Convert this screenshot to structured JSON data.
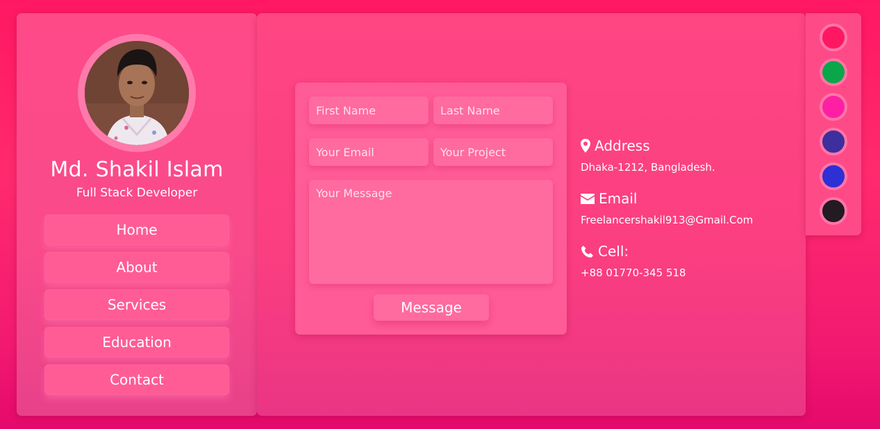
{
  "profile": {
    "name": "Md. Shakil Islam",
    "role": "Full Stack Developer",
    "avatar_icon": "profile-photo"
  },
  "nav": {
    "items": [
      {
        "label": "Home"
      },
      {
        "label": "About"
      },
      {
        "label": "Services"
      },
      {
        "label": "Education"
      },
      {
        "label": "Contact"
      }
    ]
  },
  "form": {
    "first_name_placeholder": "First Name",
    "last_name_placeholder": "Last Name",
    "email_placeholder": "Your Email",
    "project_placeholder": "Your Project",
    "message_placeholder": "Your Message",
    "submit_label": "Message"
  },
  "contact": {
    "address": {
      "icon": "map-marker-icon",
      "title": "Address",
      "value": "Dhaka-1212, Bangladesh."
    },
    "email": {
      "icon": "envelope-icon",
      "title": "Email",
      "value": "Freelancershakil913@Gmail.Com"
    },
    "cell": {
      "icon": "phone-icon",
      "title": "Cell:",
      "value": "+88 01770-345 518"
    }
  },
  "theme_colors": [
    "#ff1763",
    "#0aa64a",
    "#ff1fa5",
    "#3d2f9e",
    "#2f2fd6",
    "#231a22"
  ]
}
